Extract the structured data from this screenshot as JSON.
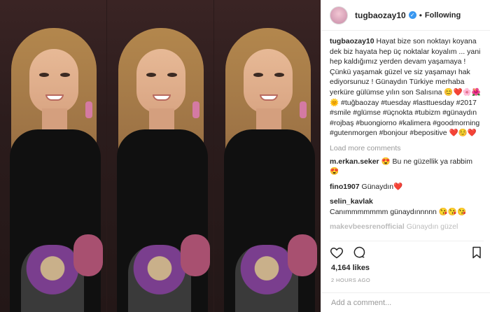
{
  "post": {
    "username": "tugbaozay10",
    "follow_status": "Following",
    "separator": "•",
    "caption_text": "Hayat bize son noktayı koyana dek biz hayata hep üç noktalar koyalım ... yani hep kaldığımız yerden devam yaşamaya ! Çünkü yaşamak güzel ve siz yaşamayı hak ediyorsunuz ! Günaydın Türkiye merhaba yerküre gülümse yılın son Salısına 😊❤️🌸🌺🌞 #tuğbaozay #tuesday #lasttuesday #2017 #smile #glümse #üçnokta #tubizm #günaydın #rojbaş #buongiorno #kalimera #goodmorning #gutenmorgen #bonjour #bepositive ❤️☺️❤️",
    "load_more": "Load more comments",
    "comments": [
      {
        "user": "m.erkan.seker",
        "text": "😍 Bu ne güzellik ya rabbim 😍"
      },
      {
        "user": "fino1907",
        "text": "Günaydın❤️"
      },
      {
        "user": "selin_kavlak",
        "text": "Canımmmmmmm günaydınnnnn 😘😘😘"
      },
      {
        "user": "makevbeesrenofficial",
        "text": "Günaydın güzel"
      }
    ],
    "likes": "4,164 likes",
    "date": "2 HOURS AGO",
    "add_comment_placeholder": "Add a comment..."
  },
  "icons": {
    "verified": "✓",
    "heart": "heart-icon",
    "comment": "comment-icon",
    "bookmark": "bookmark-icon"
  }
}
